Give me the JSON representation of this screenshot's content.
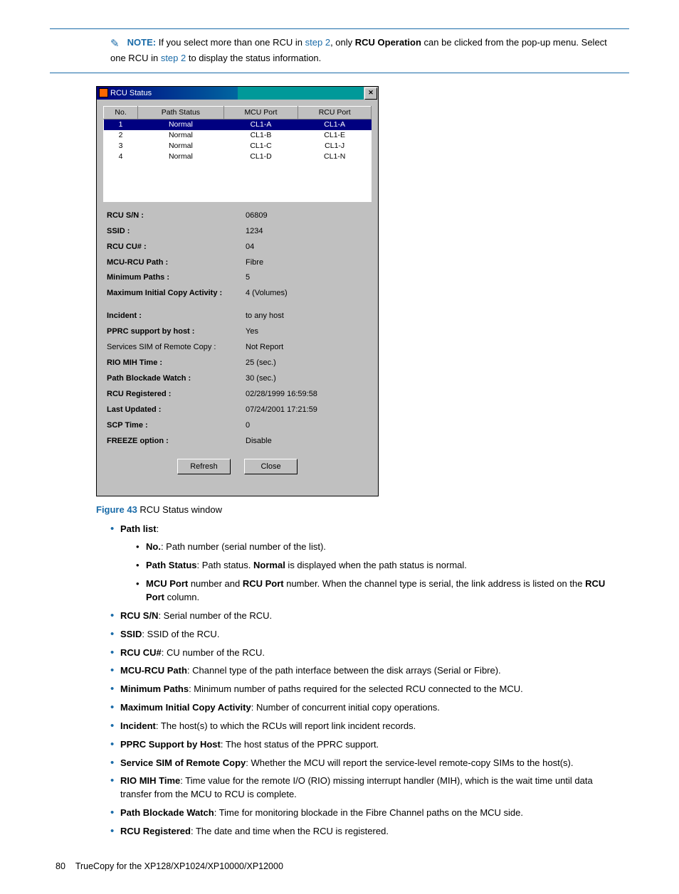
{
  "note": {
    "label": "NOTE:",
    "text_a": "If you select more than one RCU in ",
    "link1": "step 2",
    "text_b": ", only ",
    "bold1": "RCU Operation",
    "text_c": " can be clicked from the pop-up menu. Select one RCU in ",
    "link2": "step 2",
    "text_d": " to display the status information."
  },
  "dialog": {
    "title": "RCU Status",
    "close": "✕",
    "columns": {
      "c1": "No.",
      "c2": "Path Status",
      "c3": "MCU Port",
      "c4": "RCU Port"
    },
    "rows": [
      {
        "no": "1",
        "status": "Normal",
        "mcu": "CL1-A",
        "rcu": "CL1-A"
      },
      {
        "no": "2",
        "status": "Normal",
        "mcu": "CL1-B",
        "rcu": "CL1-E"
      },
      {
        "no": "3",
        "status": "Normal",
        "mcu": "CL1-C",
        "rcu": "CL1-J"
      },
      {
        "no": "4",
        "status": "Normal",
        "mcu": "CL1-D",
        "rcu": "CL1-N"
      }
    ],
    "details": [
      {
        "label": "RCU S/N :",
        "value": "06809"
      },
      {
        "label": "SSID :",
        "value": "1234"
      },
      {
        "label": "RCU CU# :",
        "value": "04"
      },
      {
        "label": "MCU-RCU Path :",
        "value": "Fibre"
      },
      {
        "label": "Minimum Paths :",
        "value": "5"
      },
      {
        "label": "Maximum Initial Copy Activity :",
        "value": "4 (Volumes)"
      }
    ],
    "details2": [
      {
        "label": "Incident :",
        "value": "to any host"
      },
      {
        "label": "PPRC support by host :",
        "value": "Yes"
      },
      {
        "label": "Services SIM of Remote Copy :",
        "value": "Not Report"
      },
      {
        "label": "RIO MIH Time :",
        "value": "25 (sec.)"
      },
      {
        "label": "Path Blockade Watch :",
        "value": "30 (sec.)"
      },
      {
        "label": "RCU Registered :",
        "value": "02/28/1999 16:59:58"
      },
      {
        "label": "Last Updated :",
        "value": "07/24/2001 17:21:59"
      },
      {
        "label": "SCP Time :",
        "value": "0"
      },
      {
        "label": "FREEZE option :",
        "value": "Disable"
      }
    ],
    "btn_refresh": "Refresh",
    "btn_close": "Close"
  },
  "caption": {
    "num": "Figure 43",
    "text": " RCU Status window"
  },
  "list": {
    "pathlist_label": "Path list",
    "no_label": "No.",
    "no_text": ": Path number (serial number of the list).",
    "ps_label": "Path Status",
    "ps_text_a": ": Path status. ",
    "ps_bold": "Normal",
    "ps_text_b": " is displayed when the path status is normal.",
    "port_bold1": "MCU Port",
    "port_mid": " number and ",
    "port_bold2": "RCU Port",
    "port_text": " number. When the channel type is serial, the link address is listed on the ",
    "port_bold3": "RCU Port",
    "port_text2": " column.",
    "sn_label": "RCU S/N",
    "sn_text": ": Serial number of the RCU.",
    "ssid_label": "SSID",
    "ssid_text": ": SSID of the RCU.",
    "cu_label": "RCU CU#",
    "cu_text": ": CU number of the RCU.",
    "mcu_label": "MCU-RCU Path",
    "mcu_text": ": Channel type of the path interface between the disk arrays (Serial or Fibre).",
    "min_label": "Minimum Paths",
    "min_text": ": Minimum number of paths required for the selected RCU connected to the MCU.",
    "max_label": "Maximum Initial Copy Activity",
    "max_text": ": Number of concurrent initial copy operations.",
    "inc_label": "Incident",
    "inc_text": ": The host(s) to which the RCUs will report link incident records.",
    "pprc_label": "PPRC Support by Host",
    "pprc_text": ": The host status of the PPRC support.",
    "sim_label": "Service SIM of Remote Copy",
    "sim_text": ": Whether the MCU will report the service-level remote-copy SIMs to the host(s).",
    "rio_label": "RIO MIH Time",
    "rio_text": ": Time value for the remote I/O (RIO) missing interrupt handler (MIH), which is the wait time until data transfer from the MCU to RCU is complete.",
    "pbw_label": "Path Blockade Watch",
    "pbw_text": ": Time for monitoring blockade in the Fibre Channel paths on the MCU side.",
    "reg_label": "RCU Registered",
    "reg_text": ": The date and time when the RCU is registered."
  },
  "footer": {
    "page": "80",
    "title": "TrueCopy for the XP128/XP1024/XP10000/XP12000"
  }
}
